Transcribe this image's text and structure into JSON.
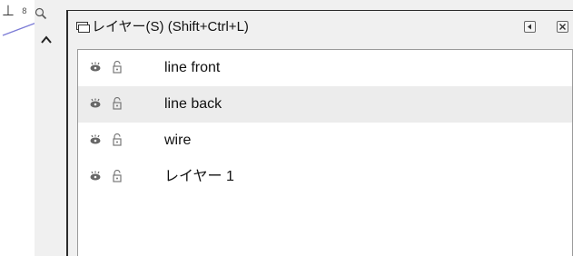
{
  "left_toolbar": {
    "ruler_glyph": "⊥",
    "ruler_small": "8"
  },
  "panel": {
    "title": "レイヤー(S) (Shift+Ctrl+L)",
    "layers": [
      {
        "name": "line front",
        "visible": true,
        "locked": false,
        "selected": false
      },
      {
        "name": "line back",
        "visible": true,
        "locked": false,
        "selected": true
      },
      {
        "name": "wire",
        "visible": true,
        "locked": false,
        "selected": false
      },
      {
        "name": "レイヤー 1",
        "visible": true,
        "locked": false,
        "selected": false
      }
    ]
  },
  "colors": {
    "panel_bg": "#f0f0f0",
    "list_bg": "#ffffff",
    "selected_row": "#ececec",
    "canvas_line": "#7b7bd6"
  }
}
